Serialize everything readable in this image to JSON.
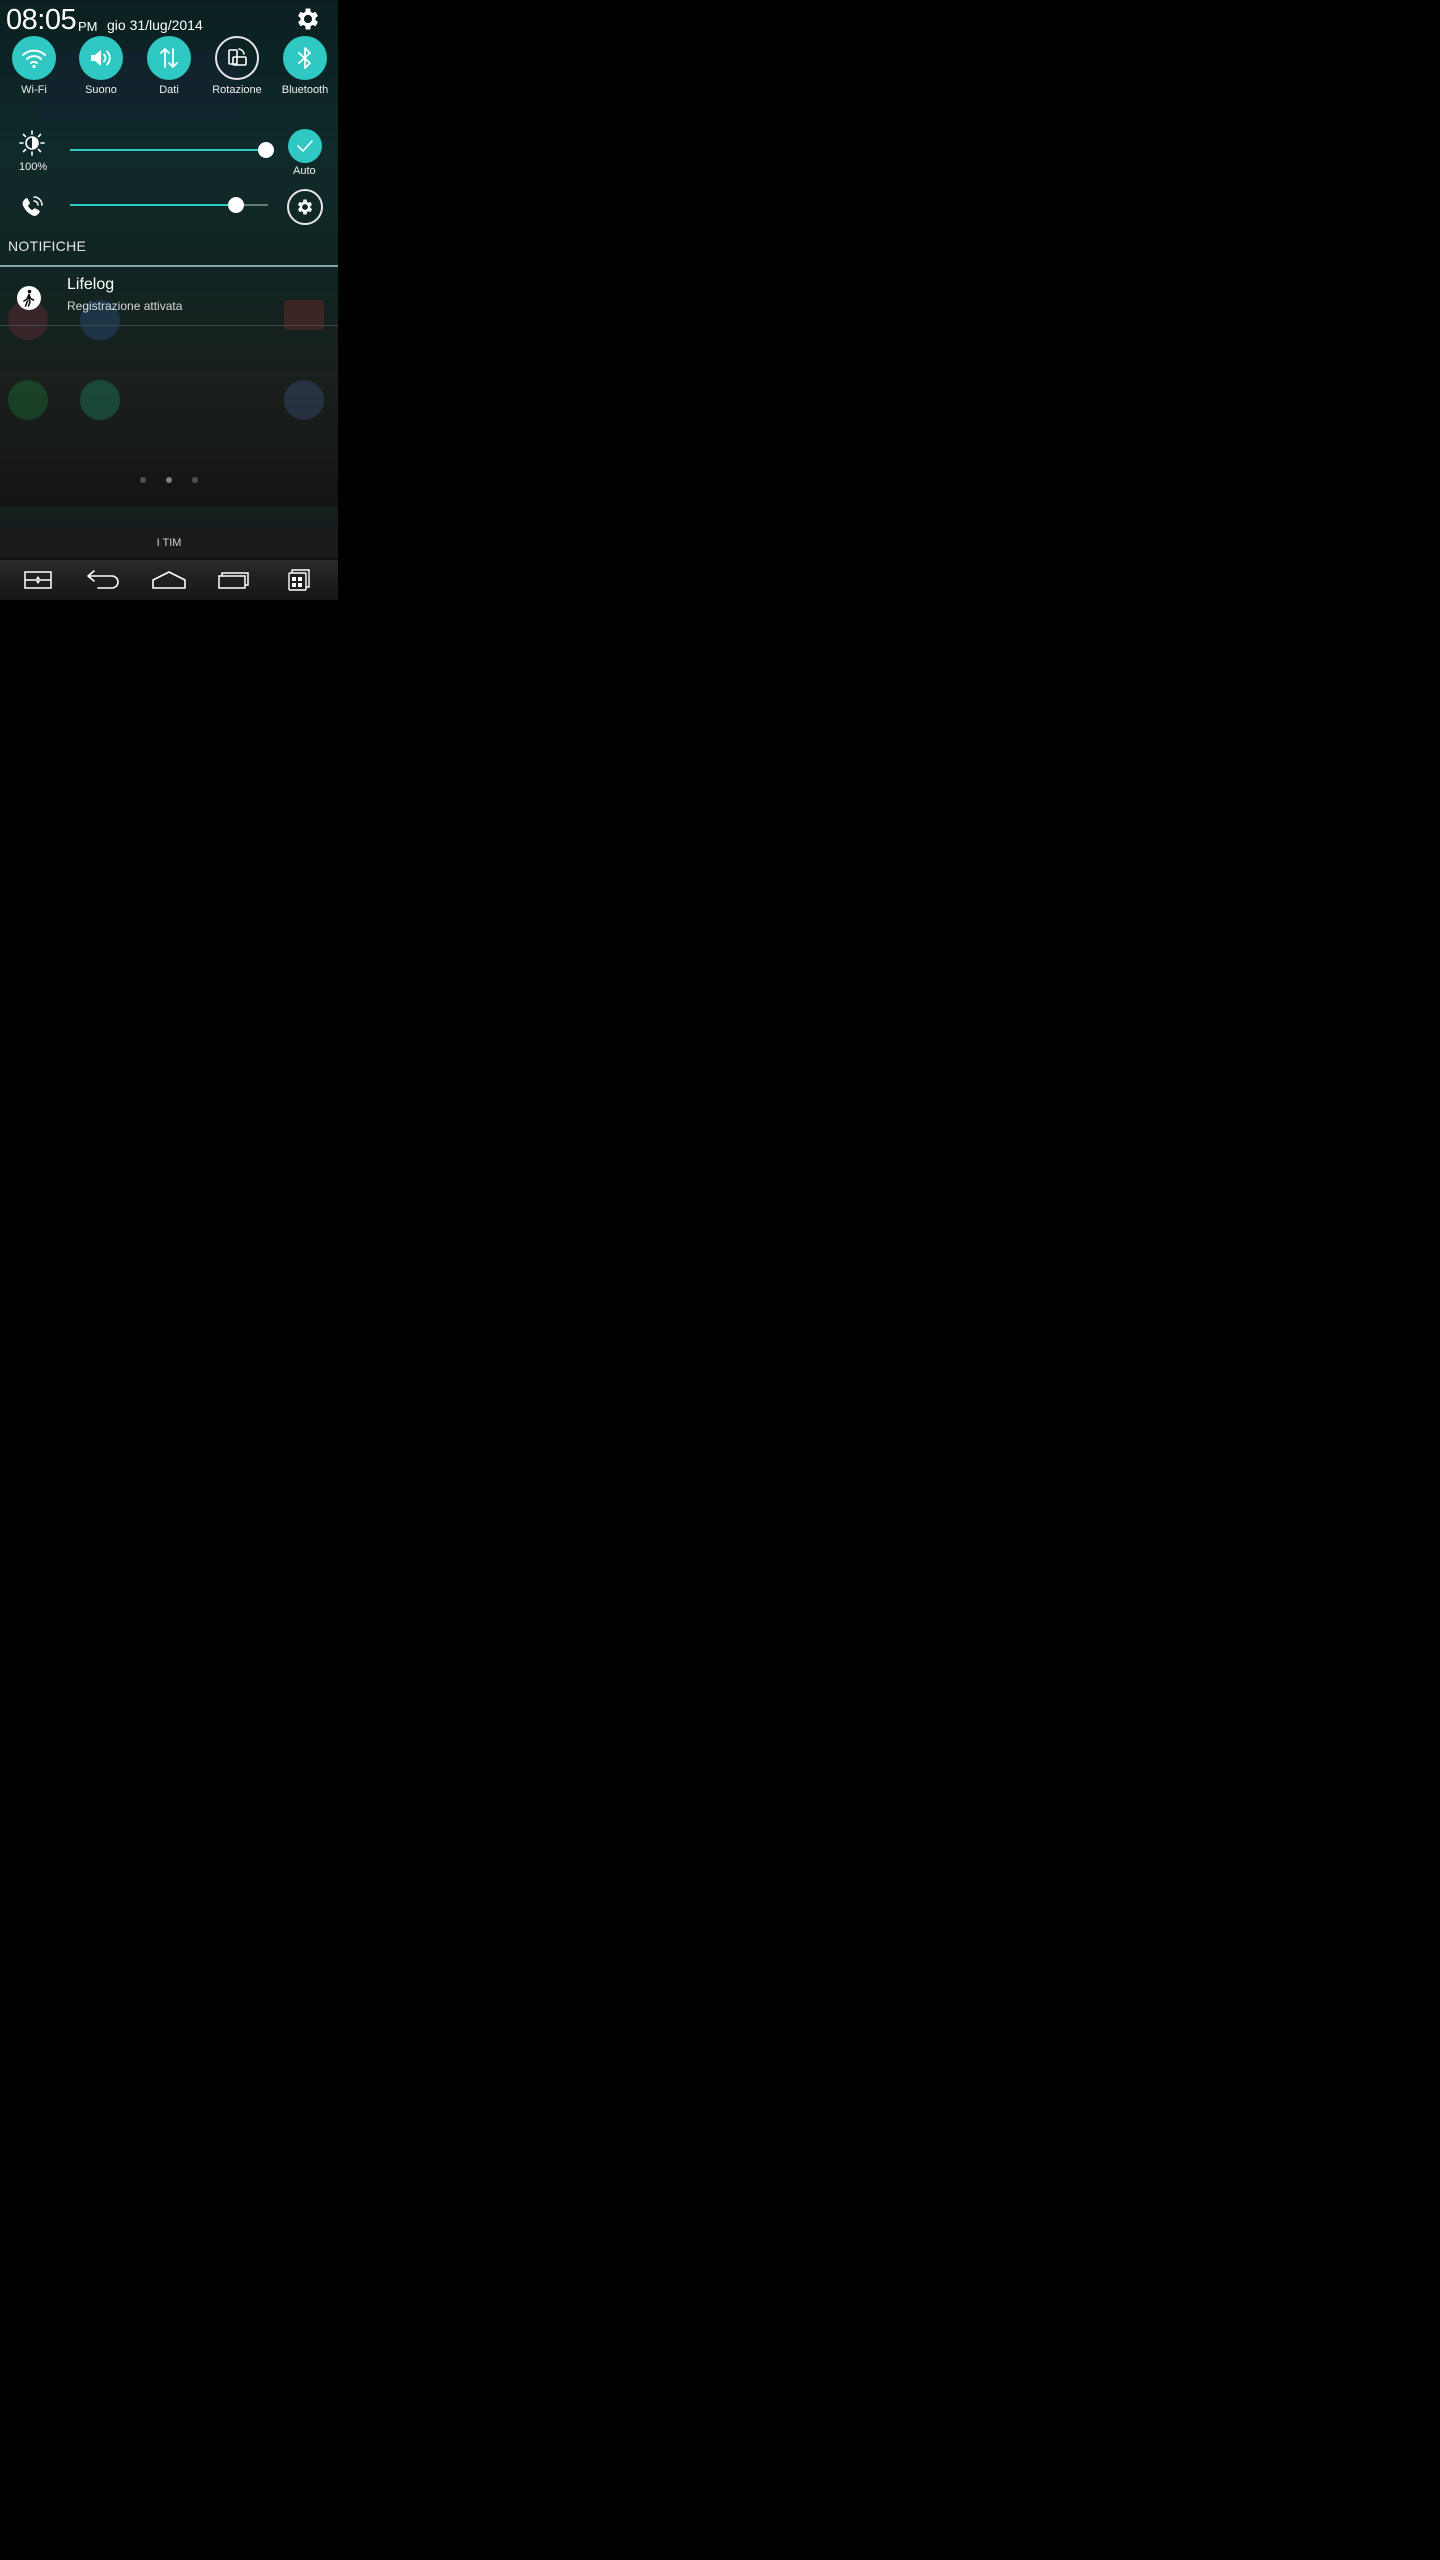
{
  "status": {
    "time": "08:05",
    "ampm": "PM",
    "date": "gio 31/lug/2014"
  },
  "quick_settings": {
    "toggles": [
      {
        "label": "Wi-Fi",
        "icon": "wifi-icon",
        "on": true
      },
      {
        "label": "Suono",
        "icon": "speaker-icon",
        "on": true
      },
      {
        "label": "Dati",
        "icon": "data-arrows-icon",
        "on": true
      },
      {
        "label": "Rotazione",
        "icon": "rotation-icon",
        "on": false
      },
      {
        "label": "Bluetooth",
        "icon": "bluetooth-icon",
        "on": true
      }
    ],
    "brightness": {
      "value_label": "100%",
      "level": 1.0,
      "auto_label": "Auto",
      "auto_on": true
    },
    "volume": {
      "level": 0.84,
      "icon": "phone-ring-icon"
    }
  },
  "notifications": {
    "header": "NOTIFICHE",
    "items": [
      {
        "title": "Lifelog",
        "text": "Registrazione attivata",
        "icon": "walking-person-icon"
      }
    ]
  },
  "carrier": "I TIM",
  "nav": {
    "buttons": [
      "dual-window-icon",
      "back-icon",
      "home-icon",
      "recent-apps-icon",
      "qslide-icon"
    ]
  },
  "colors": {
    "accent": "#2fc8c2",
    "background": "#000000"
  }
}
